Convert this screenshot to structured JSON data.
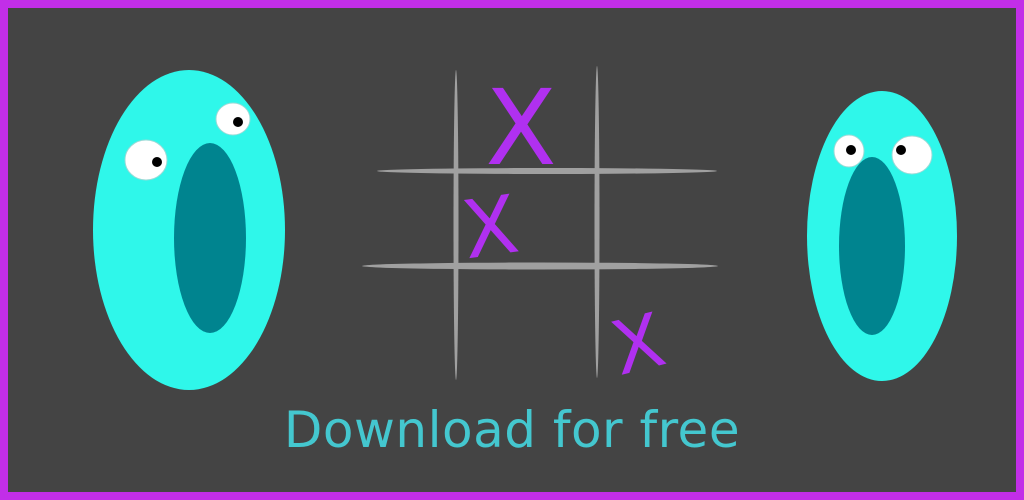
{
  "banner": {
    "cta_text": "Download for free"
  },
  "board": {
    "marks": [
      {
        "cell": "top-middle",
        "symbol": "X"
      },
      {
        "cell": "middle-left",
        "symbol": "X"
      },
      {
        "cell": "bottom-right",
        "symbol": "X"
      }
    ]
  },
  "characters": [
    {
      "name": "o-character-left",
      "shape": "letter O with eyes"
    },
    {
      "name": "o-character-right",
      "shape": "letter O with eyes"
    }
  ],
  "colors": {
    "border": "#c22ee8",
    "background": "#444444",
    "o_body": "#2ff7ea",
    "o_mouth": "#00848f",
    "x_mark": "#b030f0",
    "grid_line": "#a0a0a0",
    "cta_text": "#44c7cf"
  }
}
